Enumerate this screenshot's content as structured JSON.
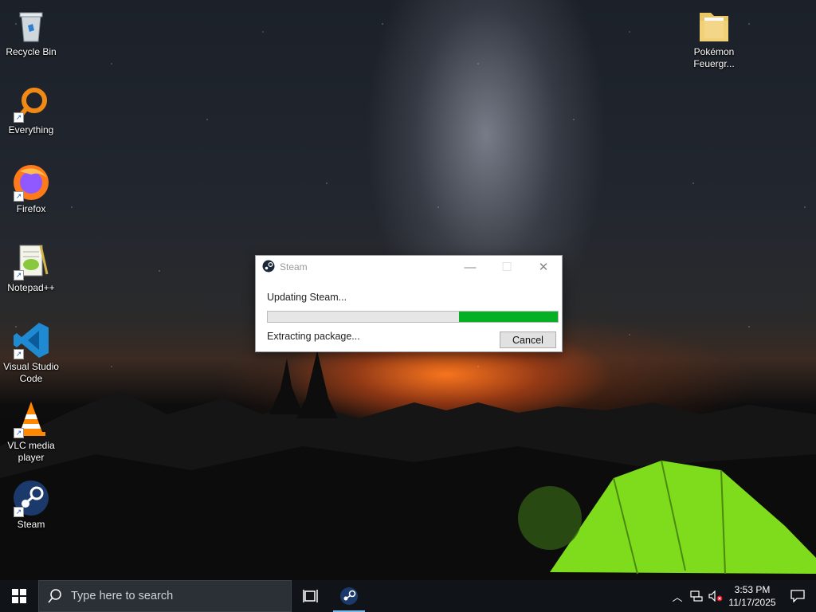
{
  "desktop_icons": [
    {
      "label": "Recycle Bin",
      "icon": "recycle-bin-icon"
    },
    {
      "label": "Everything",
      "icon": "everything-search-icon"
    },
    {
      "label": "Firefox",
      "icon": "firefox-icon"
    },
    {
      "label": "Notepad++",
      "icon": "notepad-plus-plus-icon"
    },
    {
      "label": "Visual Studio Code",
      "icon": "vscode-icon"
    },
    {
      "label": "VLC media player",
      "icon": "vlc-icon"
    },
    {
      "label": "Steam",
      "icon": "steam-icon"
    },
    {
      "label": "Pokémon Feuergr...",
      "icon": "folder-icon"
    }
  ],
  "dialog": {
    "title": "Steam",
    "status": "Updating Steam...",
    "progress": 0.34,
    "substatus": "Extracting package...",
    "cancel_label": "Cancel",
    "progress_color": "#06b025"
  },
  "taskbar": {
    "search_placeholder": "Type here to search",
    "time": "3:53 PM",
    "date": "11/17/2025",
    "accent": "#76b9ed"
  }
}
